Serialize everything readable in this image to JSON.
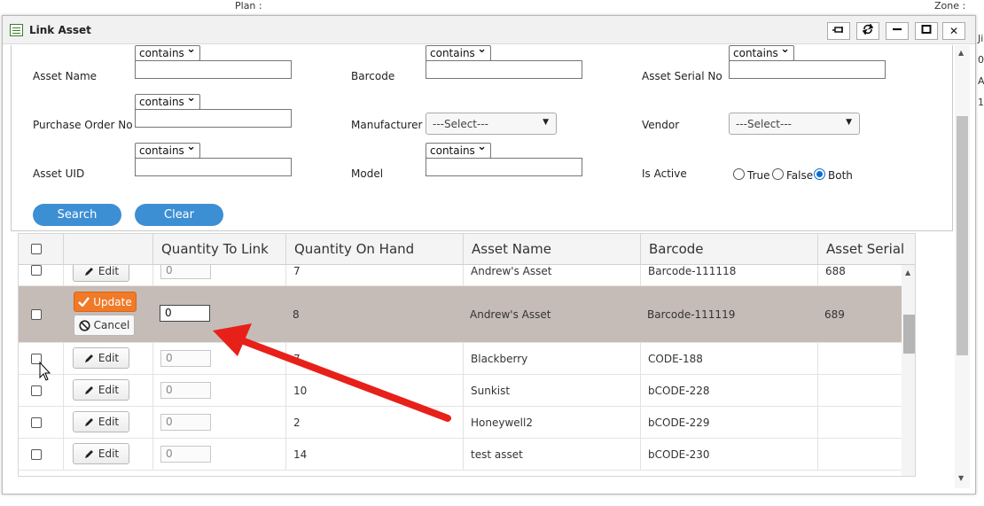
{
  "background": {
    "top_left_text": "Plan :",
    "top_right_text": "Zone :",
    "right_chars": [
      "Ji",
      "0",
      "A",
      "1"
    ]
  },
  "dialog": {
    "title": "Link Asset",
    "window_buttons": [
      "pin-icon",
      "refresh-icon",
      "minimize-icon",
      "maximize-icon",
      "close-icon"
    ],
    "close_glyph": "✕",
    "minimize_glyph": "—",
    "maximize_glyph": "☐"
  },
  "filters": {
    "asset_name": {
      "label": "Asset Name",
      "operator": "contains",
      "value": ""
    },
    "barcode": {
      "label": "Barcode",
      "operator": "contains",
      "value": ""
    },
    "asset_serial_no": {
      "label": "Asset Serial No",
      "operator": "contains",
      "value": ""
    },
    "purchase_order_no": {
      "label": "Purchase Order No",
      "operator": "contains",
      "value": ""
    },
    "manufacturer": {
      "label": "Manufacturer",
      "selected": "---Select---"
    },
    "vendor": {
      "label": "Vendor",
      "selected": "---Select---"
    },
    "asset_uid": {
      "label": "Asset UID",
      "operator": "contains",
      "value": ""
    },
    "model": {
      "label": "Model",
      "operator": "contains",
      "value": ""
    },
    "is_active": {
      "label": "Is Active",
      "options": [
        "True",
        "False",
        "Both"
      ],
      "selected": "Both"
    }
  },
  "buttons": {
    "search": "Search",
    "clear": "Clear"
  },
  "grid": {
    "columns": [
      "",
      "",
      "Quantity To Link",
      "Quantity On Hand",
      "Asset Name",
      "Barcode",
      "Asset Serial"
    ],
    "edit_label": "Edit",
    "update_label": "Update",
    "cancel_label": "Cancel",
    "rows": [
      {
        "qty_to_link": "0",
        "qty_on_hand": "7",
        "asset_name": "Andrew's Asset",
        "barcode": "Barcode-111118",
        "serial": "688"
      },
      {
        "qty_to_link": "0",
        "qty_on_hand": "8",
        "asset_name": "Andrew's Asset",
        "barcode": "Barcode-111119",
        "serial": "689",
        "editing": true
      },
      {
        "qty_to_link": "0",
        "qty_on_hand": "7",
        "asset_name": "Blackberry",
        "barcode": "CODE-188",
        "serial": ""
      },
      {
        "qty_to_link": "0",
        "qty_on_hand": "10",
        "asset_name": "Sunkist",
        "barcode": "bCODE-228",
        "serial": ""
      },
      {
        "qty_to_link": "0",
        "qty_on_hand": "2",
        "asset_name": "Honeywell2",
        "barcode": "bCODE-229",
        "serial": ""
      },
      {
        "qty_to_link": "0",
        "qty_on_hand": "14",
        "asset_name": "test asset",
        "barcode": "bCODE-230",
        "serial": ""
      }
    ]
  },
  "annotation": {
    "color": "#e8201a"
  }
}
